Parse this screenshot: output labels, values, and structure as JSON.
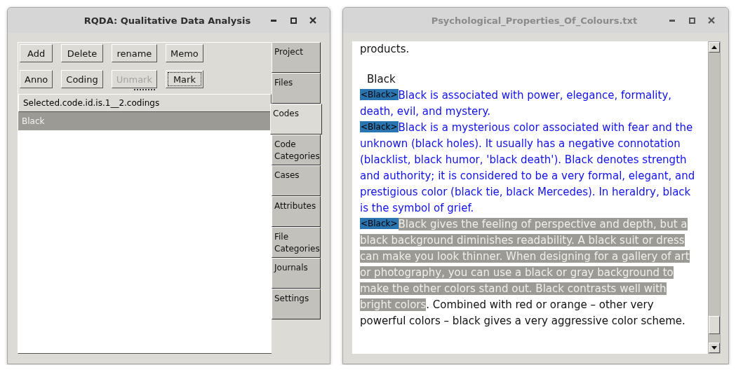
{
  "windows": [
    {
      "kind": "rqda",
      "title": "RQDA: Qualitative Data Analysis",
      "active": true,
      "buttons": [
        {
          "label": "Add",
          "disabled": false,
          "focused": false
        },
        {
          "label": "Delete",
          "disabled": false,
          "focused": false
        },
        {
          "label": "rename",
          "disabled": false,
          "focused": false
        },
        {
          "label": "Memo",
          "disabled": false,
          "focused": false
        },
        {
          "label": "Anno",
          "disabled": false,
          "focused": false
        },
        {
          "label": "Coding",
          "disabled": false,
          "focused": false
        },
        {
          "label": "Unmark",
          "disabled": true,
          "focused": false
        },
        {
          "label": "Mark",
          "disabled": false,
          "focused": true
        }
      ],
      "list_header": "Selected.code.id.is.1__2.codings",
      "codes": [
        {
          "label": "Black",
          "selected": true
        }
      ],
      "tabs": [
        {
          "label": "Project",
          "selected": false
        },
        {
          "label": "Files",
          "selected": false
        },
        {
          "label": "Codes",
          "selected": true
        },
        {
          "label": "Code Categories",
          "selected": false
        },
        {
          "label": "Cases",
          "selected": false
        },
        {
          "label": "Attributes",
          "selected": false
        },
        {
          "label": "File Categories",
          "selected": false
        },
        {
          "label": "Journals",
          "selected": false
        },
        {
          "label": "Settings",
          "selected": false
        }
      ]
    },
    {
      "kind": "document",
      "title": "Psychological_Properties_Of_Colours.txt",
      "active": false,
      "paragraphs": [
        {
          "kind": "plain",
          "segments": [
            {
              "kind": "plain",
              "text": "products."
            }
          ]
        },
        {
          "kind": "heading",
          "segments": [
            {
              "kind": "plain",
              "text": "Black"
            }
          ]
        },
        {
          "kind": "coded",
          "tag": "<Black>",
          "segments": [
            {
              "kind": "coded",
              "text": "Black is associated with power, elegance, formality, death, evil, and mystery."
            }
          ]
        },
        {
          "kind": "coded",
          "tag": "<Black>",
          "segments": [
            {
              "kind": "coded",
              "text": "Black is a mysterious color associated with fear and the unknown (black holes). It usually has a negative connotation (blacklist, black humor, 'black death'). Black denotes strength and authority; it is considered to be a very formal, elegant, and prestigious color (black tie, black Mercedes). In heraldry, black is the symbol of grief."
            }
          ]
        },
        {
          "kind": "coded",
          "tag": "<Black>",
          "segments": [
            {
              "kind": "selected",
              "text": "Black gives the feeling of perspective and depth, but a black background diminishes readability. A black suit or dress can make you look thinner. When designing for a gallery of art or photography, you can use a black or gray background to make the other colors stand out. Black contrasts well with bright colors"
            },
            {
              "kind": "plain",
              "text": ". Combined with red or orange – other very powerful colors – black gives a very aggressive color scheme."
            }
          ]
        }
      ]
    }
  ]
}
